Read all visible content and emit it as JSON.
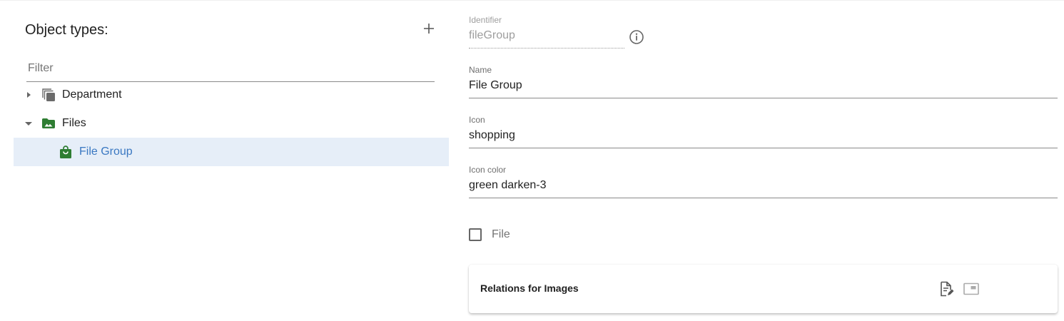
{
  "left_panel": {
    "title": "Object types:",
    "filter_placeholder": "Filter",
    "tree": [
      {
        "label": "Department",
        "icon": "copy-stack-icon",
        "expanded": false
      },
      {
        "label": "Files",
        "icon": "folder-image-icon",
        "expanded": true,
        "icon_color": "#2e7d32"
      },
      {
        "label": "File Group",
        "icon": "shopping-bag-icon",
        "selected": true,
        "icon_color": "#2e7d32"
      }
    ]
  },
  "form": {
    "identifier": {
      "label": "Identifier",
      "value": "fileGroup"
    },
    "name": {
      "label": "Name",
      "value": "File Group"
    },
    "icon": {
      "label": "Icon",
      "value": "shopping"
    },
    "icon_color": {
      "label": "Icon color",
      "value": "green darken-3"
    },
    "file_checkbox": {
      "label": "File",
      "checked": false
    }
  },
  "relations_card": {
    "title": "Relations for Images"
  },
  "colors": {
    "selected_bg": "#e6eef8",
    "selected_text": "#3a78c2",
    "green": "#2e7d32"
  }
}
